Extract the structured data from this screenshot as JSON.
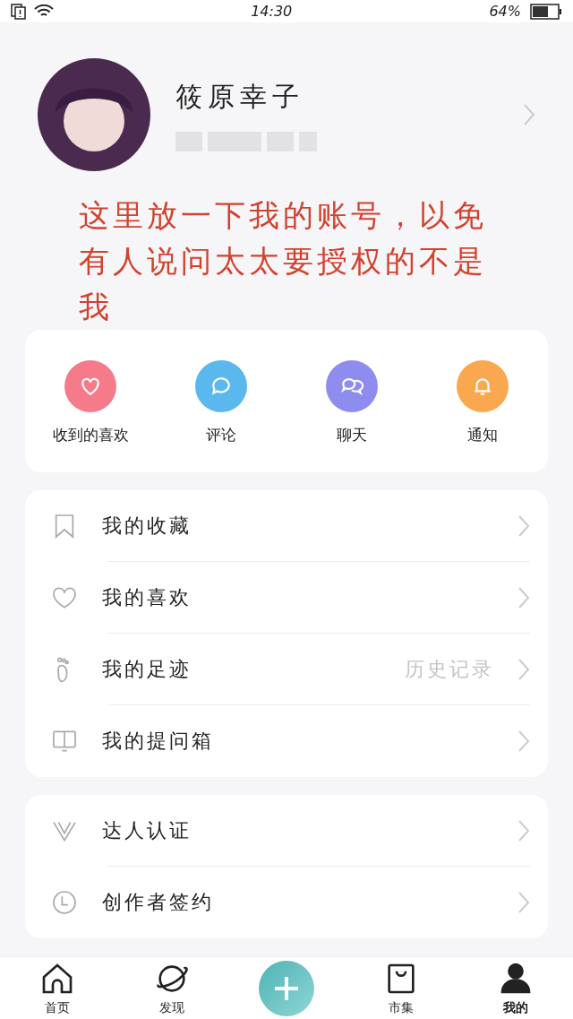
{
  "status_bar": {
    "time": "14:30",
    "battery_text": "64%"
  },
  "profile": {
    "name": "筱原幸子"
  },
  "annotation": "这里放一下我的账号，以免有人说问太太要授权的不是我",
  "quick_actions": [
    {
      "label": "收到的喜欢",
      "kind": "heart",
      "color": "#f57a8a"
    },
    {
      "label": "评论",
      "kind": "comment",
      "color": "#5ab8ee"
    },
    {
      "label": "聊天",
      "kind": "chat",
      "color": "#8f8cf0"
    },
    {
      "label": "通知",
      "kind": "bell",
      "color": "#f9a850"
    }
  ],
  "menu_groups": [
    [
      {
        "label": "我的收藏",
        "kind": "bookmark"
      },
      {
        "label": "我的喜欢",
        "kind": "heart"
      },
      {
        "label": "我的足迹",
        "kind": "foot",
        "detail": "历史记录"
      },
      {
        "label": "我的提问箱",
        "kind": "box"
      }
    ],
    [
      {
        "label": "达人认证",
        "kind": "v"
      },
      {
        "label": "创作者签约",
        "kind": "clock"
      }
    ]
  ],
  "tab_bar": [
    {
      "label": "首页",
      "kind": "home",
      "selected": false
    },
    {
      "label": "发现",
      "kind": "planet",
      "selected": false
    },
    {
      "kind": "plus",
      "selected": false
    },
    {
      "label": "市集",
      "kind": "bag",
      "selected": false
    },
    {
      "label": "我的",
      "kind": "person",
      "selected": true
    }
  ]
}
